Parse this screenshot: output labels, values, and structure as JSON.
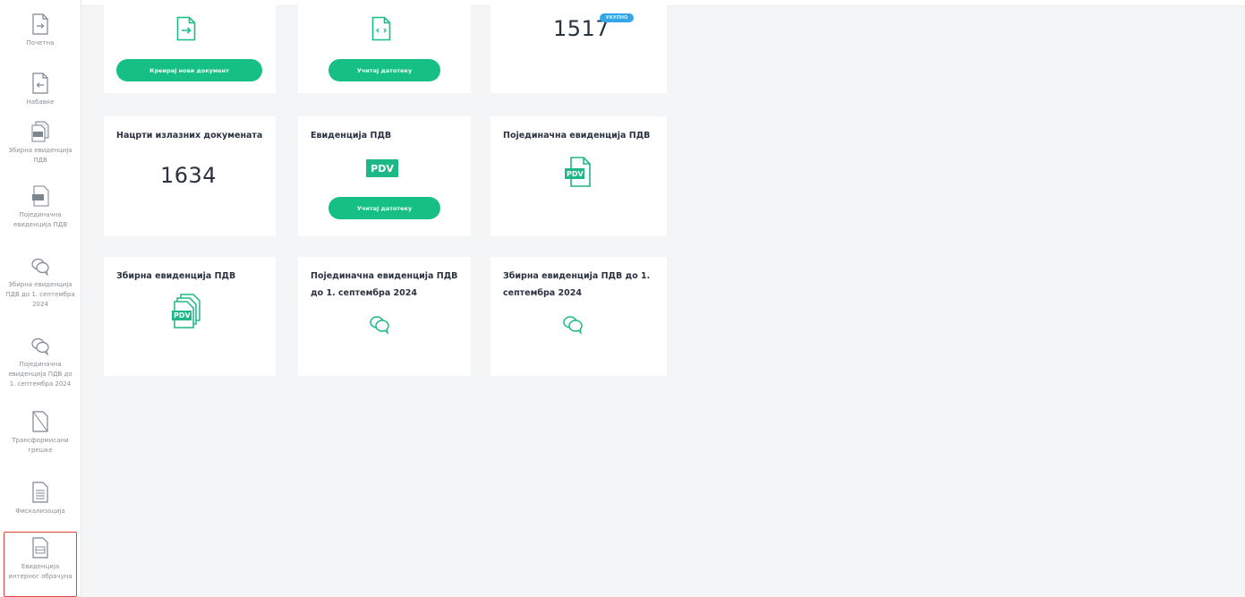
{
  "sidebar": {
    "items": [
      {
        "label": "Почетна",
        "icon": "file-arrow-right-icon"
      },
      {
        "label": "Набавке",
        "icon": "file-arrow-left-icon"
      },
      {
        "label": "Збирна евиденција ПДВ",
        "icon": "pdv-stack-icon"
      },
      {
        "label": "Појединачна евиденција ПДВ",
        "icon": "pdv-file-icon"
      },
      {
        "label": "Збирна евиденција ПДВ до 1. септембра 2024",
        "icon": "chat-bubbles-icon"
      },
      {
        "label": "Појединачна евиденција ПДВ до 1. септембра 2024",
        "icon": "chat-bubbles-icon"
      },
      {
        "label": "Трансформисани грешке",
        "icon": "file-slash-icon"
      },
      {
        "label": "Фискализација",
        "icon": "document-lines-icon"
      },
      {
        "label": "Евиденција интерног обрачуна",
        "icon": "document-lines-icon"
      }
    ]
  },
  "cards": {
    "c1": {
      "button": "Креирај нови документ",
      "icon": "file-arrow-right-icon"
    },
    "c2": {
      "button": "Учитај датотеку",
      "icon": "file-code-icon"
    },
    "c3": {
      "number": "1517",
      "badge": "УКУПНО"
    },
    "c4": {
      "title": "Нацрти излазних докумената",
      "number": "1634"
    },
    "c5": {
      "title": "Евиденција ПДВ",
      "pdv": "PDV",
      "button": "Учитај датотеку"
    },
    "c6": {
      "title": "Појединачна евиденција ПДВ",
      "pdv": "PDV"
    },
    "c7": {
      "title": "Збирна евиденција ПДВ",
      "pdv": "PDV"
    },
    "c8": {
      "title": "Појединачна евиденција ПДВ до 1. септембра 2024"
    },
    "c9": {
      "title": "Збирна евиденција ПДВ до 1. септембра 2024"
    }
  },
  "colors": {
    "accent": "#16c084",
    "badge": "#34a6e8",
    "active_border": "#e0443b"
  }
}
